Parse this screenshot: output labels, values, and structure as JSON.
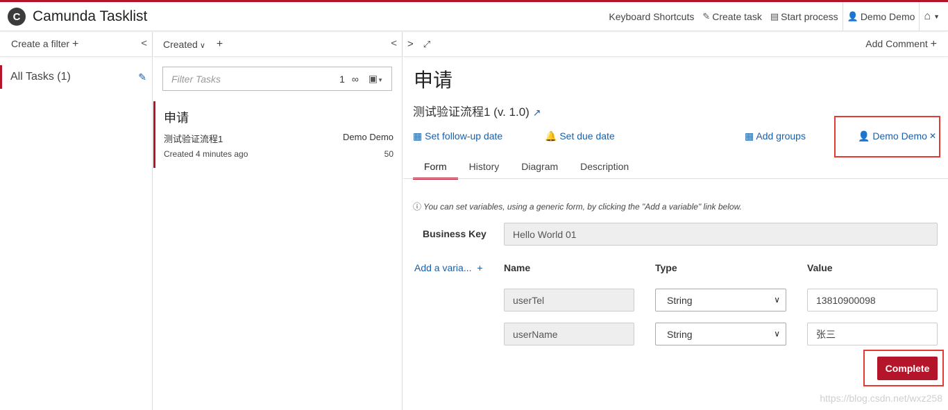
{
  "app": {
    "logo_letter": "C",
    "title": "Camunda Tasklist",
    "accent": "#b5152b"
  },
  "nav": {
    "shortcuts": "Keyboard Shortcuts",
    "create_task": "Create task",
    "start_process": "Start process",
    "user": "Demo Demo"
  },
  "filters": {
    "create_label": "Create a filter",
    "items": [
      {
        "label": "All Tasks (1)"
      }
    ]
  },
  "list": {
    "sort_label": "Created",
    "search_placeholder": "Filter Tasks",
    "search_count": "1",
    "tasks": [
      {
        "name": "申请",
        "process": "测试验证流程1",
        "assignee": "Demo Demo",
        "created": "Created 4 minutes ago",
        "priority": "50"
      }
    ]
  },
  "detail": {
    "add_comment": "Add Comment",
    "title": "申请",
    "process": "测试验证流程1 (v. 1.0)",
    "follow_up": "Set follow-up date",
    "due_date": "Set due date",
    "add_groups": "Add groups",
    "assignee": "Demo Demo",
    "tabs": [
      "Form",
      "History",
      "Diagram",
      "Description"
    ],
    "info": "You can set variables, using a generic form, by clicking the \"Add a variable\" link below.",
    "business_key_label": "Business Key",
    "business_key_value": "Hello World 01",
    "add_variable": "Add a varia...",
    "col_name": "Name",
    "col_type": "Type",
    "col_value": "Value",
    "variables": [
      {
        "name": "userTel",
        "type": "String",
        "value": "13810900098"
      },
      {
        "name": "userName",
        "type": "String",
        "value": "张三"
      }
    ],
    "complete": "Complete"
  },
  "watermark": "https://blog.csdn.net/wxz258"
}
